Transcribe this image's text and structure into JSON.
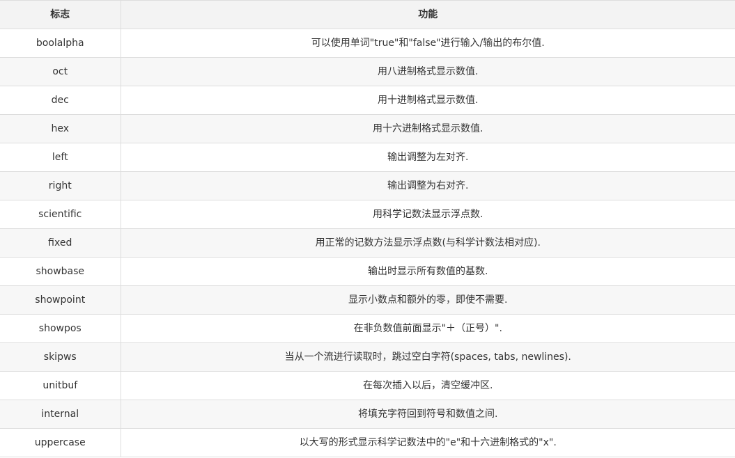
{
  "table": {
    "headers": [
      "标志",
      "功能"
    ],
    "rows": [
      [
        "boolalpha",
        "可以使用单词\"true\"和\"false\"进行输入/输出的布尔值."
      ],
      [
        "oct",
        "用八进制格式显示数值."
      ],
      [
        "dec",
        "用十进制格式显示数值."
      ],
      [
        "hex",
        "用十六进制格式显示数值."
      ],
      [
        "left",
        "输出调整为左对齐."
      ],
      [
        "right",
        "输出调整为右对齐."
      ],
      [
        "scientific",
        "用科学记数法显示浮点数."
      ],
      [
        "fixed",
        "用正常的记数方法显示浮点数(与科学计数法相对应)."
      ],
      [
        "showbase",
        "输出时显示所有数值的基数."
      ],
      [
        "showpoint",
        "显示小数点和额外的零，即使不需要."
      ],
      [
        "showpos",
        "在非负数值前面显示\"＋（正号）\"."
      ],
      [
        "skipws",
        "当从一个流进行读取时，跳过空白字符(spaces, tabs, newlines)."
      ],
      [
        "unitbuf",
        "在每次插入以后，清空缓冲区."
      ],
      [
        "internal",
        "将填充字符回到符号和数值之间."
      ],
      [
        "uppercase",
        "以大写的形式显示科学记数法中的\"e\"和十六进制格式的\"x\"."
      ]
    ]
  },
  "colors": {
    "header_bg": "#f3f3f3",
    "row_alt_bg": "#f7f7f7",
    "border": "#dddddd",
    "text": "#333333"
  }
}
